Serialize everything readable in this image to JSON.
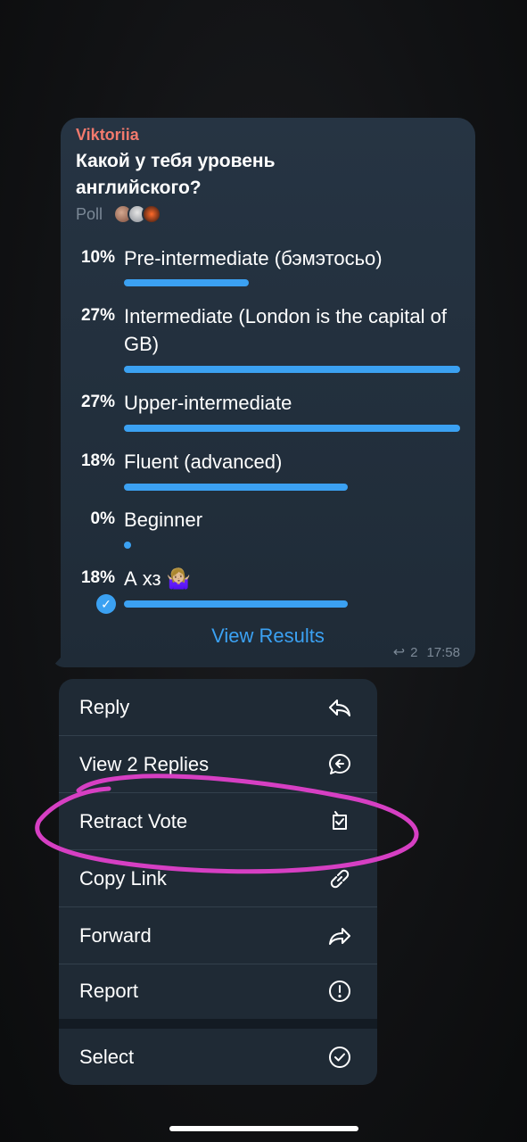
{
  "message": {
    "sender": "Viktoriia",
    "question": "Какой у тебя уровень английского?",
    "poll_type": "Poll",
    "voter_avatars": [
      "avatar-1",
      "avatar-2",
      "avatar-3"
    ],
    "options": [
      {
        "percent": "10%",
        "text": "Pre-intermediate (бэмэтосьо)",
        "value": 10
      },
      {
        "percent": "27%",
        "text": "Intermediate (London is the capital of GB)",
        "value": 27
      },
      {
        "percent": "27%",
        "text": "Upper-intermediate",
        "value": 27
      },
      {
        "percent": "18%",
        "text": "Fluent (advanced)",
        "value": 18
      },
      {
        "percent": "0%",
        "text": "Beginner",
        "value": 0
      },
      {
        "percent": "18%",
        "text": "А хз 🤷🏼‍♀️",
        "value": 18,
        "selected": true
      }
    ],
    "view_results": "View Results",
    "reply_count": "2",
    "time": "17:58"
  },
  "menu": {
    "items": [
      {
        "label": "Reply",
        "icon": "reply-icon"
      },
      {
        "label": "View 2 Replies",
        "icon": "replies-icon"
      },
      {
        "label": "Retract Vote",
        "icon": "retract-vote-icon"
      },
      {
        "label": "Copy Link",
        "icon": "link-icon"
      },
      {
        "label": "Forward",
        "icon": "forward-icon"
      },
      {
        "label": "Report",
        "icon": "report-icon"
      },
      {
        "label": "Select",
        "icon": "select-icon"
      }
    ]
  },
  "colors": {
    "accent": "#3ba1f2",
    "sender": "#f37a6d",
    "bubble": "#243240",
    "menu": "#1f2a35",
    "annotation": "#d63fc3"
  }
}
